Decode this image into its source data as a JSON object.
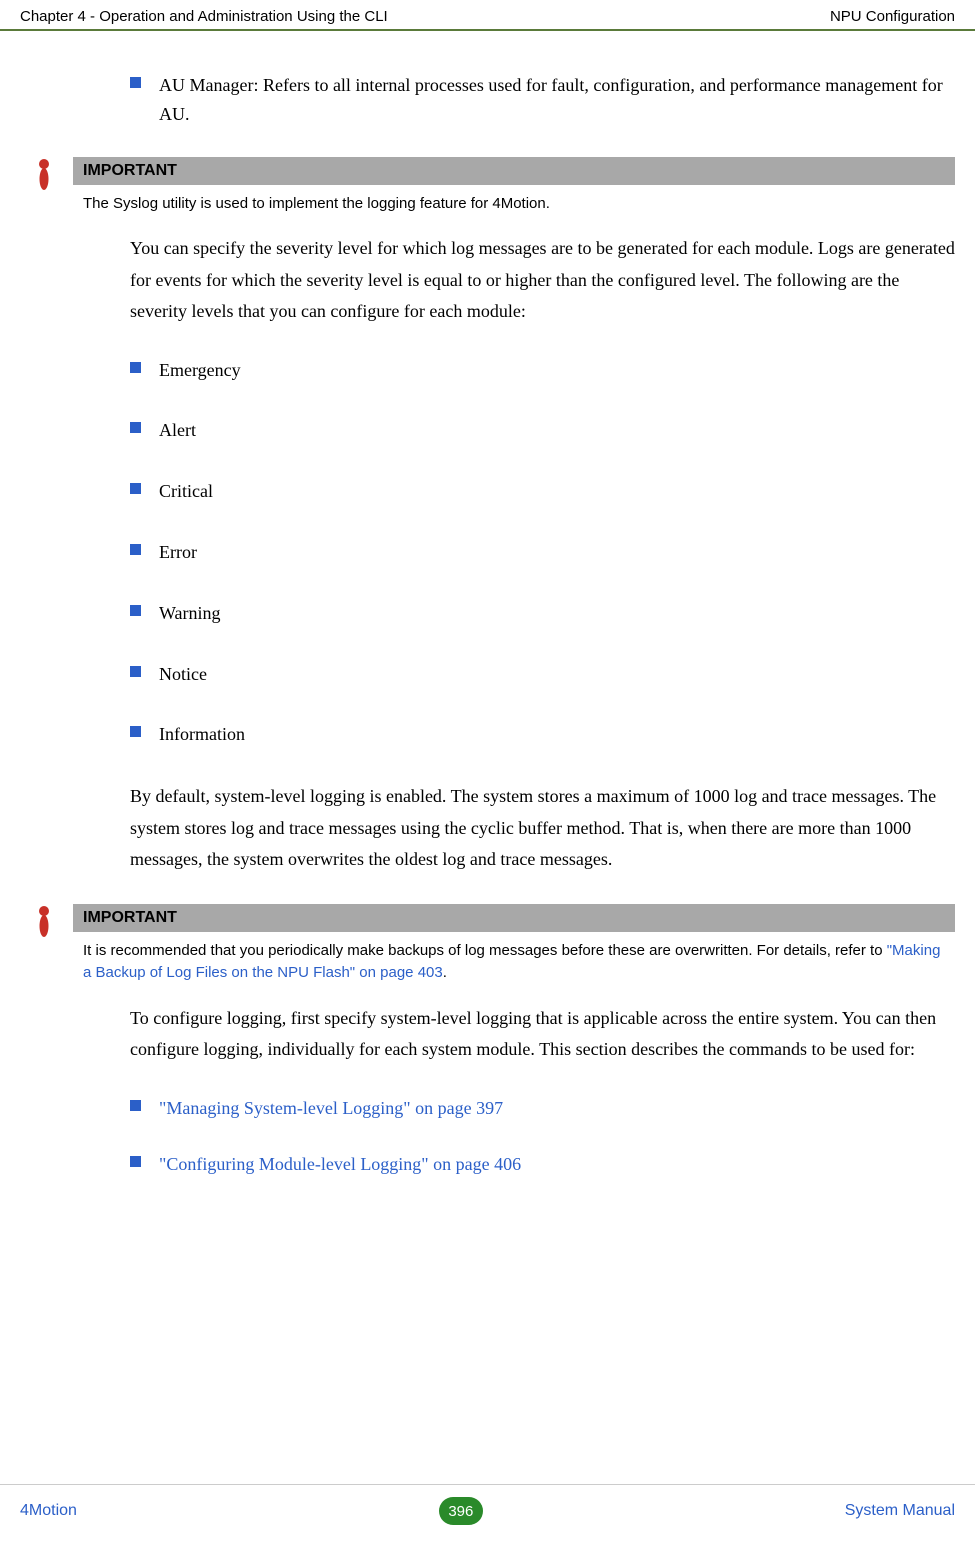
{
  "header": {
    "left": "Chapter 4 - Operation and Administration Using the CLI",
    "right": "NPU Configuration"
  },
  "intro_bullet": "AU Manager: Refers to all internal processes used for fault, configuration, and performance management for AU.",
  "important1": {
    "title": "IMPORTANT",
    "text": "The Syslog utility is used to implement the logging feature for 4Motion."
  },
  "para1": "You can specify the severity level for which log messages are to be generated for each module. Logs are generated for events for which the severity level is equal to or higher than the configured level. The following are the severity levels that you can configure for each module:",
  "severity_levels": [
    "Emergency",
    "Alert",
    "Critical",
    "Error",
    "Warning",
    "Notice",
    "Information"
  ],
  "para2": "By default, system-level logging is enabled. The system stores a maximum of 1000 log and trace messages. The system stores log and trace messages using the cyclic buffer method. That is, when there are more than 1000 messages, the system overwrites the oldest log and trace messages.",
  "important2": {
    "title": "IMPORTANT",
    "text_prefix": "It is recommended that you periodically make backups of log messages before these are overwritten. For details, refer to ",
    "link": "\"Making a Backup of Log Files on the NPU Flash\" on page 403",
    "text_suffix": "."
  },
  "para3": "To configure logging, first specify system-level logging that is applicable across the entire system. You can then configure logging, individually for each system module. This section describes the commands to be used for:",
  "links": [
    "\"Managing System-level Logging\" on page 397",
    "\"Configuring Module-level Logging\" on page 406"
  ],
  "footer": {
    "left": "4Motion",
    "page": "396",
    "right": "System Manual"
  }
}
